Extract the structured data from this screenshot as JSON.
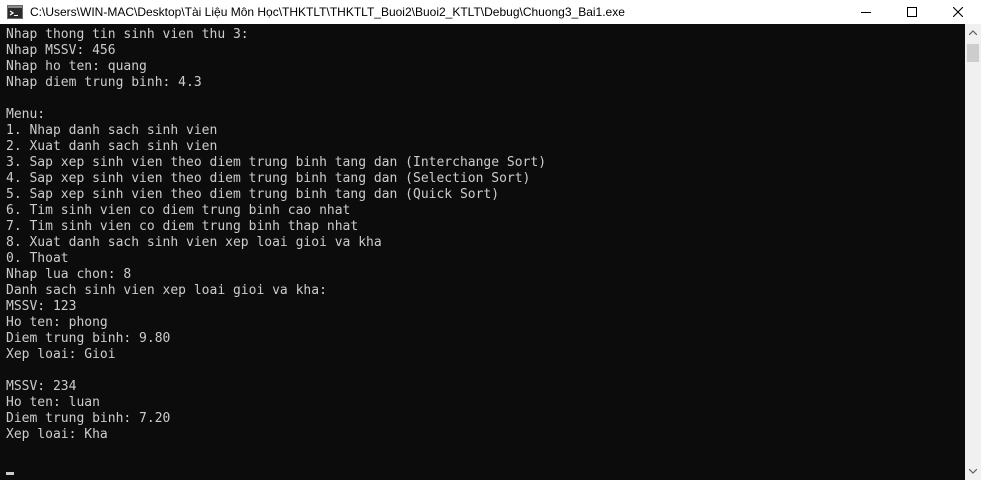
{
  "window": {
    "title": "C:\\Users\\WIN-MAC\\Desktop\\Tài Liệu Môn Học\\THKTLT\\THKTLT_Buoi2\\Buoi2_KTLT\\Debug\\Chuong3_Bai1.exe",
    "app_icon": "console-app-icon",
    "controls": {
      "minimize_icon": "minimize-icon",
      "maximize_icon": "maximize-icon",
      "close_icon": "close-icon"
    }
  },
  "console": {
    "lines": [
      "Nhap thong tin sinh vien thu 3:",
      "Nhap MSSV: 456",
      "Nhap ho ten: quang",
      "Nhap diem trung binh: 4.3",
      "",
      "Menu:",
      "1. Nhap danh sach sinh vien",
      "2. Xuat danh sach sinh vien",
      "3. Sap xep sinh vien theo diem trung binh tang dan (Interchange Sort)",
      "4. Sap xep sinh vien theo diem trung binh tang dan (Selection Sort)",
      "5. Sap xep sinh vien theo diem trung binh tang dan (Quick Sort)",
      "6. Tim sinh vien co diem trung binh cao nhat",
      "7. Tim sinh vien co diem trung binh thap nhat",
      "8. Xuat danh sach sinh vien xep loai gioi va kha",
      "0. Thoat",
      "Nhap lua chon: 8",
      "Danh sach sinh vien xep loai gioi va kha:",
      "MSSV: 123",
      "Ho ten: phong",
      "Diem trung binh: 9.80",
      "Xep loai: Gioi",
      "",
      "MSSV: 234",
      "Ho ten: luan",
      "Diem trung binh: 7.20",
      "Xep loai: Kha",
      "",
      ""
    ]
  },
  "scrollbar": {
    "up_icon": "scroll-up-arrow-icon",
    "down_icon": "scroll-down-arrow-icon"
  },
  "colors": {
    "console_background": "#0c0c0c",
    "console_text": "#cccccc",
    "titlebar_background": "#ffffff"
  }
}
